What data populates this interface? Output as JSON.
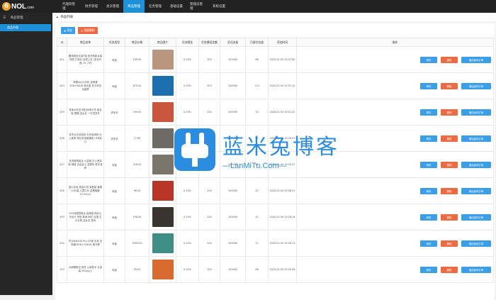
{
  "header": {
    "logo_glyph": "6",
    "logo_text": "NOL",
    "logo_suffix": ".com",
    "nav": [
      "代理商管理",
      "财务管理",
      "会员管理",
      "商品管理",
      "任务管理",
      "基础设置",
      "管理员管理",
      "系统设置"
    ],
    "active_nav": 3
  },
  "sidebar": {
    "section_label": "商品管理",
    "items": [
      {
        "label": "商品列表"
      }
    ]
  },
  "breadcrumb": {
    "label": "商品列表"
  },
  "toolbar": {
    "add_label": "添加",
    "batch_delete_label": "批量删除"
  },
  "table": {
    "columns": [
      "ID",
      "商品名称",
      "任务类型",
      "商品价格",
      "商品图片",
      "任务佣金",
      "任务最低金额",
      "总任务量",
      "已接任务量",
      "添加时间",
      "操作"
    ],
    "rows": [
      {
        "id": "441",
        "name": "圆领纯色长袖T恤 秋冬新款女装内搭 打底衫 百搭上衣 (多色可选) 34.7/件",
        "type": "淘宝",
        "price": "249.50",
        "commission": "0.10%",
        "min": "200",
        "total": "100000",
        "taken": "68",
        "time": "2020-01-04 19:37:40",
        "img": "#b9977e"
      },
      {
        "id": "440",
        "name": "荣耀play3手机 全网通 4GB+64GB 极光蓝 双卡双待 全面屏",
        "type": "淘宝",
        "price": "879.00",
        "commission": "0.10%",
        "min": "200",
        "total": "100000",
        "taken": "110",
        "time": "2020-01-04 19:37:15",
        "img": "#1b6fae"
      },
      {
        "id": "439",
        "name": "零食大礼包 网红休闲小吃 组合装 整箱 送女友 一件顶多件",
        "type": "拼多多",
        "price": "199.00",
        "commission": "0.10%",
        "min": "200",
        "total": "100000",
        "taken": "74",
        "time": "2020-01-04 19:31:02",
        "img": "#c9553c"
      },
      {
        "id": "438",
        "name": "鲁杰丝无线鼠标 可充电静音 办公家用 笔记本电脑通用 USB接口",
        "type": "拼多多",
        "price": "77.80",
        "commission": "0.10%",
        "min": "200",
        "total": "100000",
        "taken": "65",
        "time": "2020-01-04 19:30:01",
        "img": "#6e6a66"
      },
      {
        "id": "437",
        "name": "多肉植物组合 小盆栽 办公室桌面 绿植 含盆含土 送肥料 新手易养",
        "type": "淘宝",
        "price": "318.00",
        "commission": "0.10%",
        "min": "200",
        "total": "100000",
        "taken": "98",
        "time": "2020-01-04 19:30:37",
        "img": "#7b766c"
      },
      {
        "id": "436",
        "name": "进口冻品 精选牛排 家庭装 套餐 10片装 儿童牛扒 送黑椒酱 20.30min",
        "type": "淘宝",
        "price": "98.50",
        "commission": "0.10%",
        "min": "200",
        "total": "100000",
        "taken": "25",
        "time": "2020-01-04 19:28:51",
        "img": "#b73427"
      },
      {
        "id": "435",
        "name": "925纯银项链女 锁骨链 简约小众设计 吊坠 韩版 网红 百搭 生日礼物 送女友 首饰",
        "type": "淘宝",
        "price": "158.00",
        "commission": "0.10%",
        "min": "200",
        "total": "100000",
        "taken": "32",
        "time": "2020-01-04 19:28:14",
        "img": "#3b3330"
      },
      {
        "id": "434",
        "name": "华为Mate30 Pro 5G版 手机 全网通 8GB+256GB 翡冷翠",
        "type": "淘宝",
        "price": "5999.00",
        "commission": "0.10%",
        "min": "200",
        "total": "100000",
        "taken": "11",
        "time": "2020-01-04 19:26:13",
        "img": "#3f8e86"
      },
      {
        "id": "433",
        "name": "大闸蟹鲜活 现货 公母各半 礼盒装 500g以上",
        "type": "淘宝",
        "price": "59.90",
        "commission": "0.10%",
        "min": "200",
        "total": "100000",
        "taken": "68",
        "time": "2020-01-04 19:25:46",
        "img": "#d8692f"
      }
    ],
    "ops": {
      "edit": "修改",
      "delete": "删除",
      "task": "增加返利订单"
    }
  },
  "watermark": {
    "cn": "蓝米兔博客",
    "en": "—LanMiTu.Com—"
  }
}
